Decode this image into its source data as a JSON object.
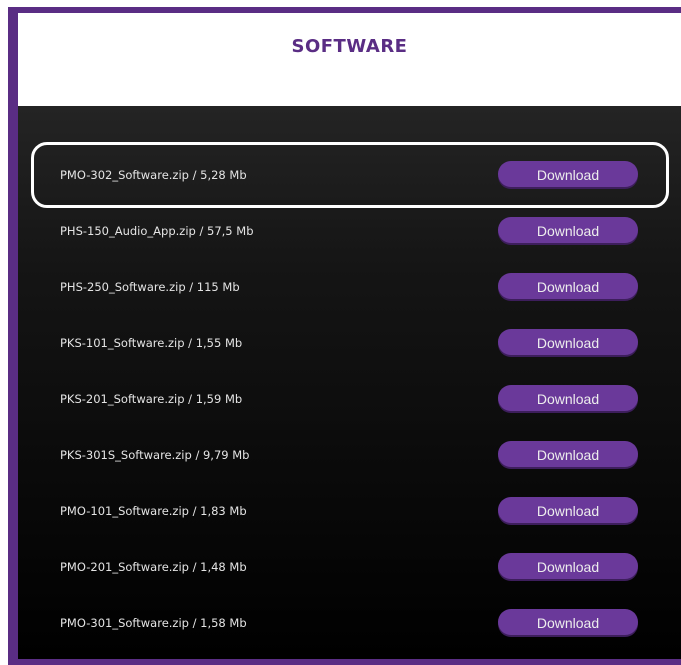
{
  "title": "SOFTWARE",
  "download_label": "Download",
  "files": [
    "PMO-302_Software.zip / 5,28 Mb",
    "PHS-150_Audio_App.zip / 57,5 Mb",
    "PHS-250_Software.zip / 115 Mb",
    "PKS-101_Software.zip / 1,55 Mb",
    "PKS-201_Software.zip / 1,59 Mb",
    "PKS-301S_Software.zip / 9,79 Mb",
    "PMO-101_Software.zip / 1,83 Mb",
    "PMO-201_Software.zip / 1,48 Mb",
    "PMO-301_Software.zip / 1,58 Mb"
  ],
  "colors": {
    "accent": "#5a2d84",
    "button": "#6a399a",
    "highlight": "#ffffff"
  }
}
